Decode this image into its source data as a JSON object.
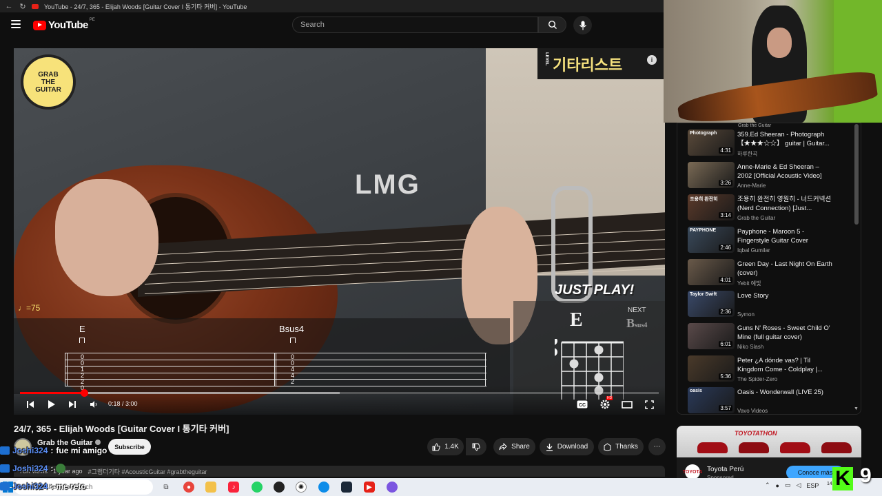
{
  "browser": {
    "tab_title": "YouTube - 24/7, 365 - Elijah Woods [Guitar Cover I 통기타 커버] - YouTube"
  },
  "masthead": {
    "logo_text": "YouTube",
    "country_code": "PE",
    "search_placeholder": "Search"
  },
  "video_overlay": {
    "brand_badge_korean": "기타리스트",
    "brand_badge_side": "LEVEL",
    "logo_lines": [
      "GRAB",
      "THE",
      "GUITAR"
    ],
    "body_logo": "LMG",
    "just_play": "JUST PLAY!",
    "tempo": "♩=75",
    "chords_on_tab": [
      "E",
      "Bsus4"
    ],
    "tab_column_1": [
      "0",
      "0",
      "1",
      "2",
      "2",
      "0"
    ],
    "tab_column_2": [
      "0",
      "0",
      "4",
      "4",
      "2"
    ],
    "current_chord": "E",
    "next_label": "NEXT",
    "next_chord_main": "B",
    "next_chord_sub": "sus4"
  },
  "player": {
    "current_time": "0:18",
    "duration": "3:00",
    "progress_fraction": 0.1,
    "buffered_fraction": 0.5,
    "hd_badge": "HD"
  },
  "video": {
    "title": "24/7, 365 - Elijah Woods [Guitar Cover I 통기타 커버]",
    "channel_name": "Grab the Guitar",
    "subscribe_label": "Subscribe",
    "like_count": "1.4K",
    "share_label": "Share",
    "download_label": "Download",
    "thanks_label": "Thanks",
    "views": "78K views",
    "age": "1 year ago",
    "tags": "#그랩더기타 #AcousticGuitar #grabtheguitar"
  },
  "chat": [
    {
      "user": "Joshi324",
      "message": "fue mi amigo"
    },
    {
      "user": "Joshi324",
      "message": ""
    },
    {
      "user": "Joshi324",
      "message": "me reto"
    }
  ],
  "sidebar": {
    "prev_channel": "Grab the Guitar",
    "items": [
      {
        "title": "359.Ed Sheeran - Photograph 【★★★☆☆】 guitar | Guitar...",
        "channel": "하루한곡",
        "duration": "4:31",
        "thumb_text": "Photograph",
        "color": "#5a4a3a"
      },
      {
        "title": "Anne-Marie & Ed Sheeran – 2002 [Official Acoustic Video]",
        "channel": "Anne-Marie",
        "duration": "3:26",
        "thumb_text": "",
        "color": "#7a6a55"
      },
      {
        "title": "조용히 완전히 영원히 - 너드커넥션(Nerd Connection) [Just...",
        "channel": "Grab the Guitar",
        "duration": "3:14",
        "thumb_text": "조용히 완전히",
        "color": "#5b3a2a"
      },
      {
        "title": "Payphone - Maroon 5 - Fingerstyle Guitar Cover",
        "channel": "Iqbal Gumilar",
        "duration": "2:46",
        "thumb_text": "PAYPHONE",
        "color": "#3a4a5c"
      },
      {
        "title": "Green Day - Last Night On Earth (cover)",
        "channel": "Yebit 예빛",
        "duration": "4:01",
        "thumb_text": "",
        "color": "#6a5a4a"
      },
      {
        "title": "Love Story",
        "channel": "Symon",
        "duration": "2:36",
        "thumb_text": "Taylor Swift",
        "color": "#3a4a6a"
      },
      {
        "title": "Guns N' Roses - Sweet Child O' Mine (full guitar cover)",
        "channel": "Niko Slash",
        "duration": "6:01",
        "thumb_text": "",
        "color": "#5a4a4a"
      },
      {
        "title": "Peter ¿A dónde vas? | Til Kingdom Come - Coldplay |...",
        "channel": "The Spider-Zero",
        "duration": "5:36",
        "thumb_text": "",
        "color": "#4a3a2a"
      },
      {
        "title": "Oasis - Wonderwall (LIVE 25)",
        "channel": "Vavo Videos",
        "duration": "3:57",
        "thumb_text": "oasis",
        "color": "#2a3a5a"
      }
    ]
  },
  "ad": {
    "banner_text": "TOYOTATHON",
    "advertiser": "Toyota Perú",
    "sponsored": "Sponsored",
    "cta": "Conoce más",
    "logo_text": "TOYOTA"
  },
  "taskbar": {
    "search_placeholder": "Type here to search",
    "language": "ESP",
    "date": "14/10/2025",
    "kick_count": "9"
  }
}
